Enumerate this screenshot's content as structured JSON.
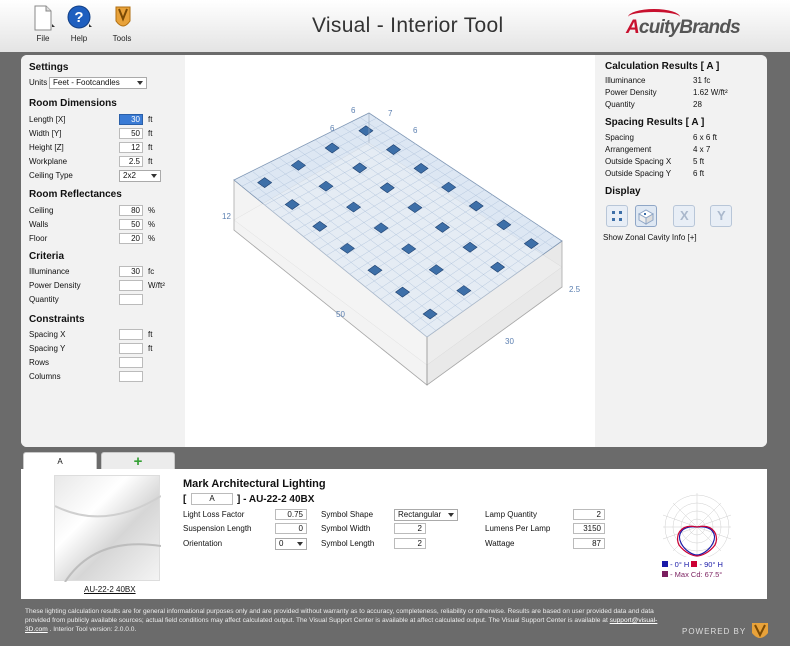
{
  "app": {
    "title": "Visual - Interior Tool",
    "brand": "AcuityBrands",
    "brand_prefix": "A",
    "brand_rest": "cuityBrands"
  },
  "toolbar": {
    "file": "File",
    "help": "Help",
    "tools": "Tools"
  },
  "settings": {
    "heading": "Settings",
    "units_label": "Units",
    "units_value": "Feet - Footcandles"
  },
  "room": {
    "heading": "Room Dimensions",
    "length": {
      "label": "Length [X]",
      "value": "30",
      "unit": "ft"
    },
    "width": {
      "label": "Width [Y]",
      "value": "50",
      "unit": "ft"
    },
    "height": {
      "label": "Height [Z]",
      "value": "12",
      "unit": "ft"
    },
    "workplane": {
      "label": "Workplane",
      "value": "2.5",
      "unit": "ft"
    },
    "ceiling_type": {
      "label": "Ceiling Type",
      "value": "2x2"
    }
  },
  "reflectances": {
    "heading": "Room Reflectances",
    "ceiling": {
      "label": "Ceiling",
      "value": "80",
      "unit": "%"
    },
    "walls": {
      "label": "Walls",
      "value": "50",
      "unit": "%"
    },
    "floor": {
      "label": "Floor",
      "value": "20",
      "unit": "%"
    }
  },
  "criteria": {
    "heading": "Criteria",
    "illuminance": {
      "label": "Illuminance",
      "value": "30",
      "unit": "fc"
    },
    "power_density": {
      "label": "Power Density",
      "value": "",
      "unit": "W/ft²"
    },
    "quantity": {
      "label": "Quantity",
      "value": ""
    }
  },
  "constraints": {
    "heading": "Constraints",
    "spacing_x": {
      "label": "Spacing X",
      "value": "",
      "unit": "ft"
    },
    "spacing_y": {
      "label": "Spacing Y",
      "value": "",
      "unit": "ft"
    },
    "rows": {
      "label": "Rows",
      "value": ""
    },
    "columns": {
      "label": "Columns",
      "value": ""
    }
  },
  "diagram": {
    "dims": {
      "top_left": "6",
      "top_right": "7",
      "side_left": "6",
      "side_right": "6",
      "height": "12",
      "length": "50",
      "width": "30",
      "workplane": "2.5"
    },
    "fixture_grid": {
      "columns": 4,
      "rows": 7
    }
  },
  "results": {
    "heading": "Calculation Results   [ A ]",
    "illuminance": {
      "label": "Illuminance",
      "value": "31 fc"
    },
    "power_density": {
      "label": "Power Density",
      "value": "1.62  W/ft²"
    },
    "quantity": {
      "label": "Quantity",
      "value": "28"
    }
  },
  "spacing": {
    "heading": "Spacing Results   [ A ]",
    "spacing": {
      "label": "Spacing",
      "value": "6 x 6  ft"
    },
    "arrangement": {
      "label": "Arrangement",
      "value": "4 x 7"
    },
    "outside_x": {
      "label": "Outside Spacing X",
      "value": "5  ft"
    },
    "outside_y": {
      "label": "Outside Spacing Y",
      "value": "6  ft"
    }
  },
  "display": {
    "heading": "Display",
    "link": "Show Zonal Cavity Info [+]",
    "x_btn": "X",
    "y_btn": "Y"
  },
  "tabs": {
    "active": "A",
    "add": "+"
  },
  "fixture": {
    "manufacturer": "Mark Architectural Lighting",
    "bracket_open": "[",
    "tag": "A",
    "model_prefix": "] - AU-22-2 40BX",
    "image_caption": "AU-22-2 40BX",
    "llf": {
      "label": "Light Loss Factor",
      "value": "0.75"
    },
    "suspension": {
      "label": "Suspension Length",
      "value": "0"
    },
    "orientation": {
      "label": "Orientation",
      "value": "0"
    },
    "symbol_shape": {
      "label": "Symbol Shape",
      "value": "Rectangular"
    },
    "symbol_width": {
      "label": "Symbol Width",
      "value": "2"
    },
    "symbol_length": {
      "label": "Symbol Length",
      "value": "2"
    },
    "lamp_quantity": {
      "label": "Lamp Quantity",
      "value": "2"
    },
    "lumens": {
      "label": "Lumens Per Lamp",
      "value": "3150"
    },
    "wattage": {
      "label": "Wattage",
      "value": "87"
    },
    "legend_0": "- 0° H",
    "legend_90": "- 90° H",
    "legend_max": "- Max Cd: 67.5°"
  },
  "footer": {
    "text1": "These lighting calculation results are for general informational purposes only and are provided without warranty as to accuracy, completeness, reliability or otherwise. Results are based on user provided data and data provided from publicly available sources; actual field conditions may affect calculated output. The Visual Support Center is available at affect calculated output. The Visual Support Center is available at",
    "email": "support@visual-3D.com",
    "text2": ". Interior Tool version: 2.0.0.0.",
    "powered": "POWERED BY"
  },
  "colors": {
    "accent": "#c8102e",
    "fixture": "#3d6fa8",
    "grid": "#b5c7de",
    "curve_0": "#1a1aa8",
    "curve_90": "#cc0033",
    "max": "#7a1f5f"
  }
}
